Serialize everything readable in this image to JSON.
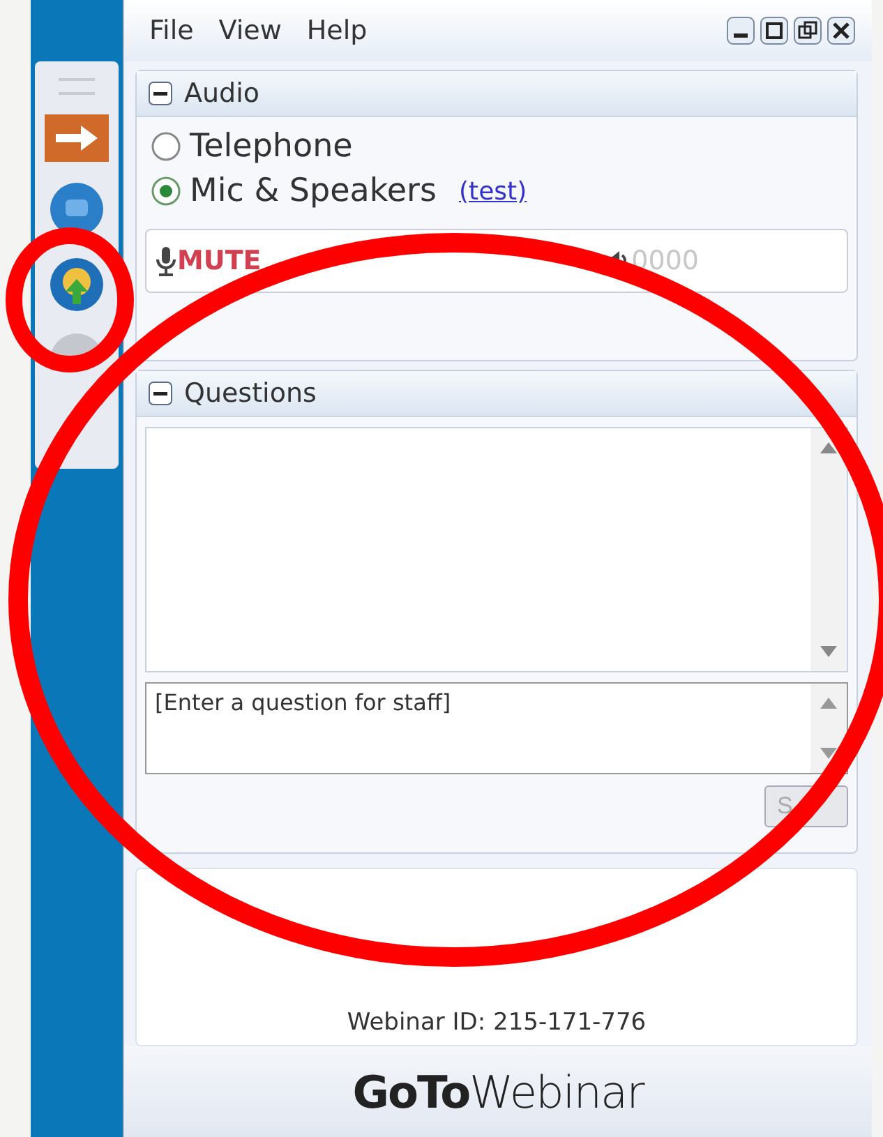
{
  "menu": [
    "File",
    "View",
    "Help"
  ],
  "audio": {
    "title": "Audio",
    "expanded": true,
    "options": [
      {
        "label": "Telephone",
        "selected": false
      },
      {
        "label": "Mic & Speakers",
        "selected": true,
        "link": "(test)"
      }
    ],
    "mic_status": "MUTE",
    "speaker_reading": "0000"
  },
  "questions": {
    "title": "Questions",
    "expanded": true,
    "placeholder": "[Enter a question for staff]",
    "send_button": "S"
  },
  "webinar_id": "Webinar ID: 215-171-776",
  "logo": {
    "bold": "GoTo",
    "rest": "Webinar"
  }
}
